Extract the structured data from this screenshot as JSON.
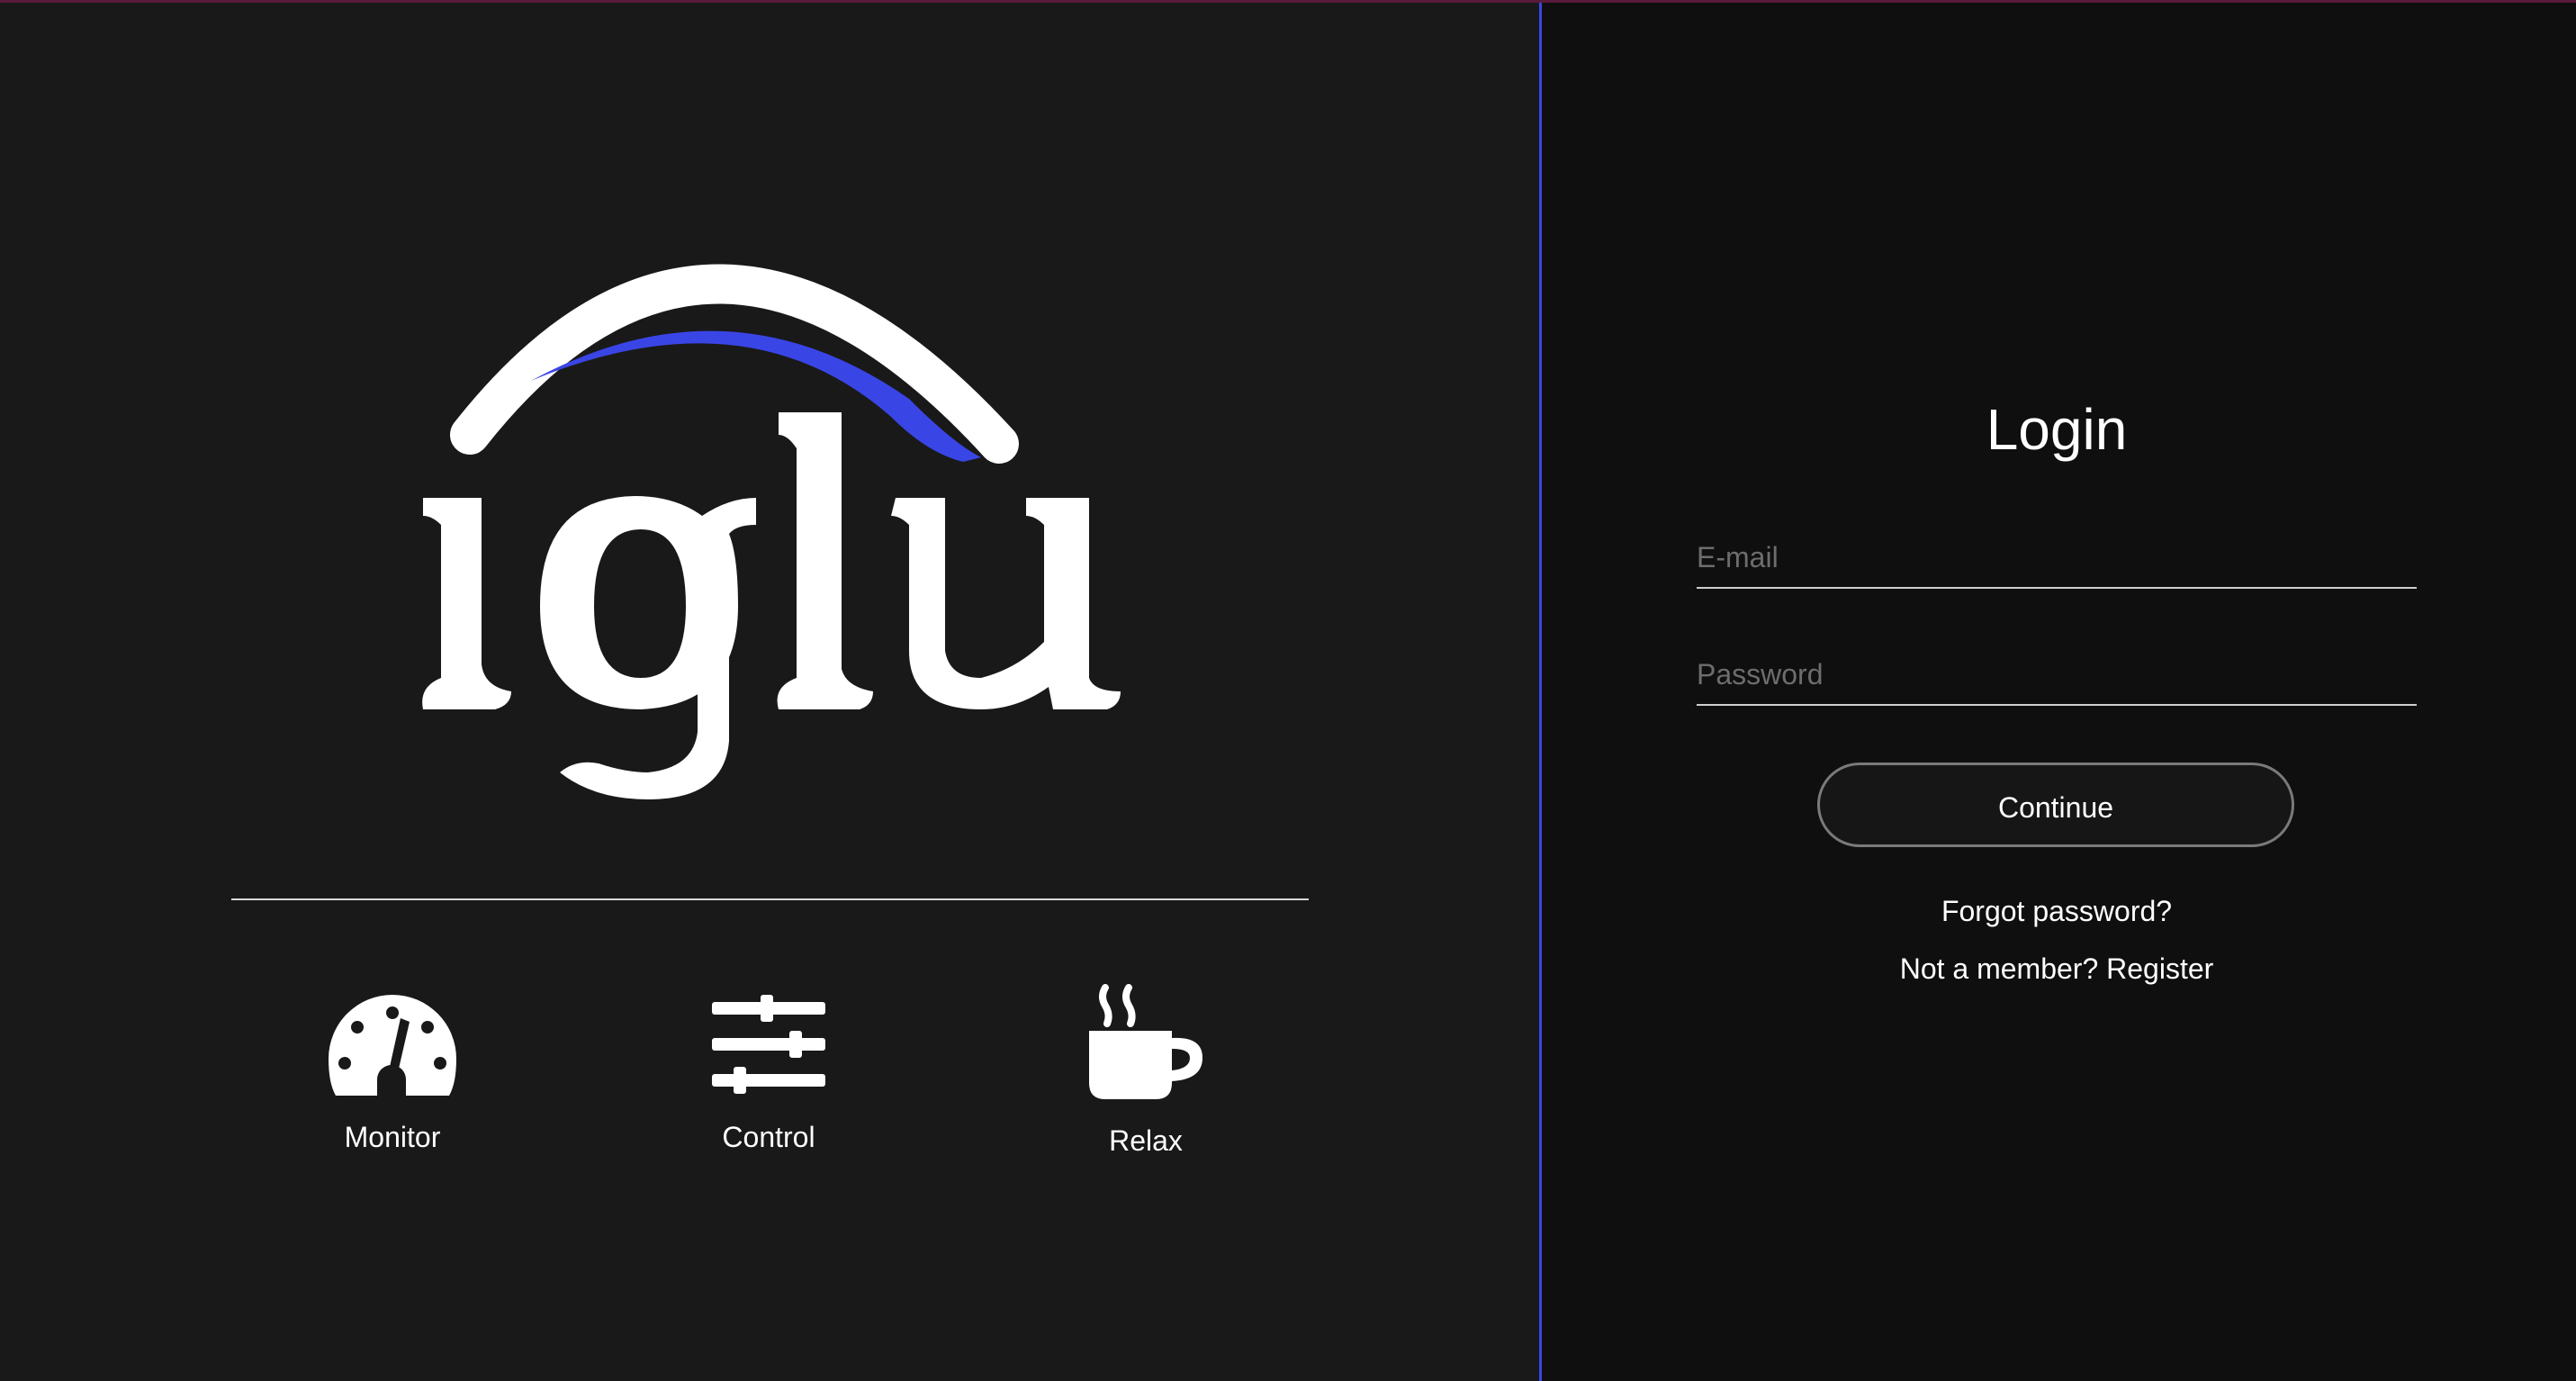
{
  "brand": {
    "logo_text": "iglu",
    "colors": {
      "accent": "#3a45e6",
      "background_left": "#191919",
      "background_right": "#0f0f0f",
      "text": "#ffffff"
    }
  },
  "features": [
    {
      "label": "Monitor",
      "icon": "gauge-icon"
    },
    {
      "label": "Control",
      "icon": "sliders-icon"
    },
    {
      "label": "Relax",
      "icon": "coffee-cup-icon"
    }
  ],
  "login": {
    "title": "Login",
    "email_placeholder": "E-mail",
    "email_value": "",
    "password_placeholder": "Password",
    "password_value": "",
    "continue_label": "Continue",
    "forgot_label": "Forgot password?",
    "register_label": "Not a member? Register"
  }
}
